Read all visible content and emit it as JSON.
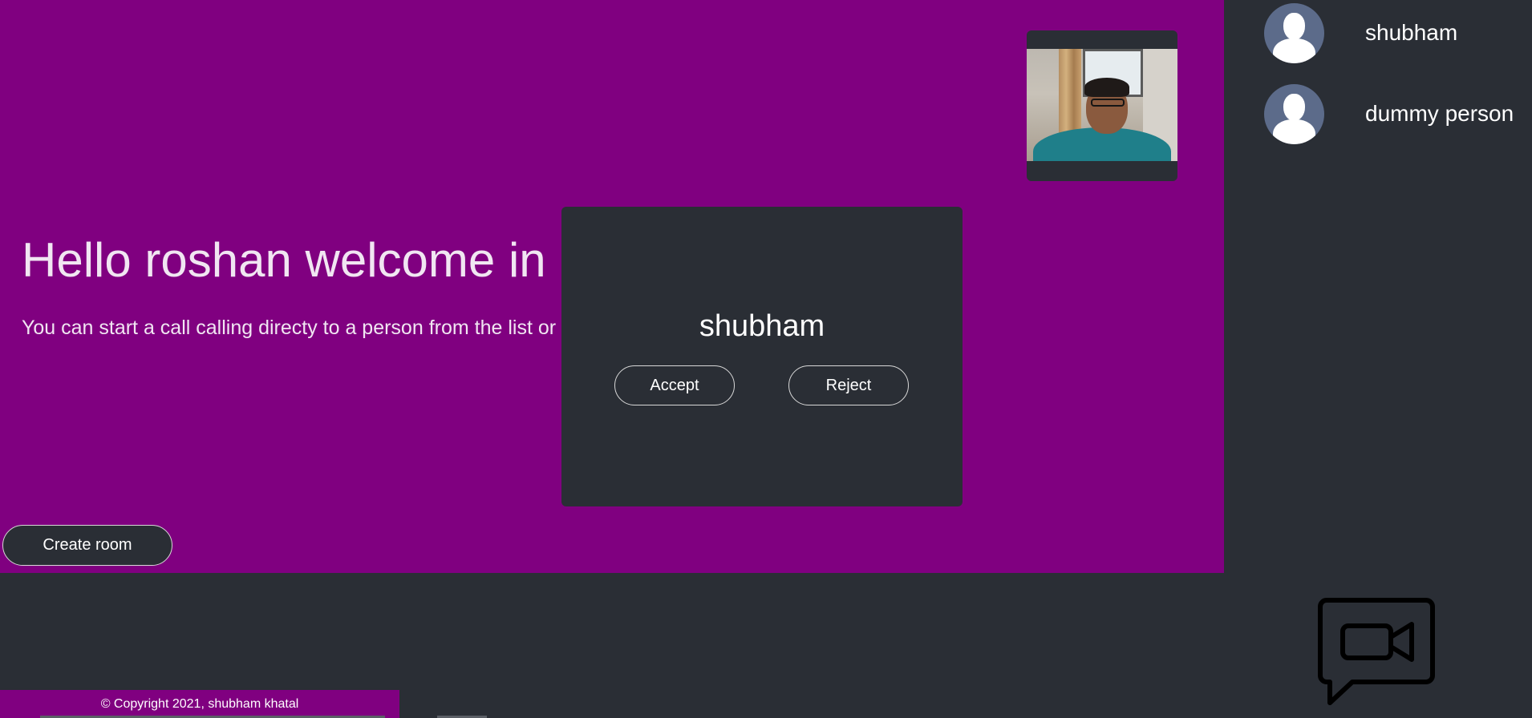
{
  "main": {
    "welcome_text": "Hello roshan welcome in",
    "subtitle": "You can start a call calling directy to a person from the list or",
    "create_room_label": "Create room",
    "background_color": "#800080"
  },
  "local_video": {
    "icon": "webcam-feed"
  },
  "incoming_call": {
    "caller_name": "shubham",
    "accept_label": "Accept",
    "reject_label": "Reject"
  },
  "sidebar": {
    "users": [
      {
        "name": "shubham",
        "avatar_icon": "default-user-icon"
      },
      {
        "name": "dummy person",
        "avatar_icon": "default-user-icon"
      }
    ]
  },
  "logo": {
    "icon": "video-chat-icon"
  },
  "footer": {
    "copyright": "© Copyright 2021, shubham khatal"
  },
  "colors": {
    "dark": "#2a2e35",
    "accent": "#800080"
  }
}
